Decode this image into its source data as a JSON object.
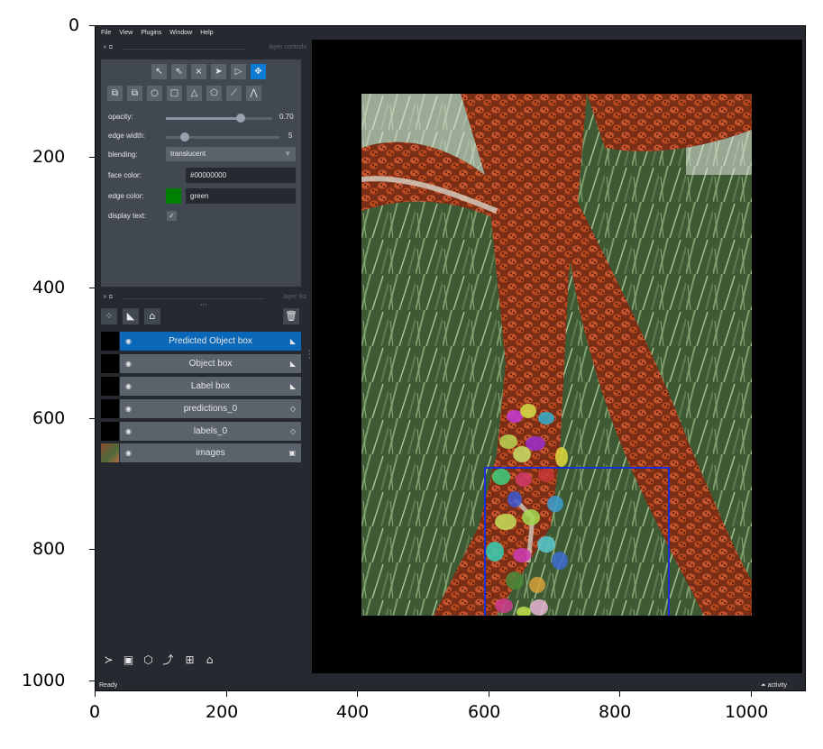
{
  "axes": {
    "x_ticks": [
      "0",
      "200",
      "400",
      "600",
      "800",
      "1000"
    ],
    "y_ticks": [
      "0",
      "200",
      "400",
      "600",
      "800",
      "1000"
    ]
  },
  "menubar": [
    "File",
    "View",
    "Plugins",
    "Window",
    "Help"
  ],
  "layer_controls": {
    "header": "layer controls",
    "opacity_label": "opacity:",
    "opacity_value": "0.70",
    "opacity_level": 0.7,
    "edge_width_label": "edge width:",
    "edge_width_value": "5",
    "blending_label": "blending:",
    "blending_value": "translucent",
    "face_color_label": "face color:",
    "face_color_value": "#00000000",
    "edge_color_label": "edge color:",
    "edge_color_value": "green",
    "edge_color_swatch": "#008000",
    "display_text_label": "display text:",
    "display_text_checked": true
  },
  "layer_list": {
    "header": "layer list",
    "layers": [
      {
        "name": "Predicted Object box",
        "type": "shapes",
        "selected": true
      },
      {
        "name": "Object box",
        "type": "shapes",
        "selected": false
      },
      {
        "name": "Label box",
        "type": "shapes",
        "selected": false
      },
      {
        "name": "predictions_0",
        "type": "labels",
        "selected": false
      },
      {
        "name": "labels_0",
        "type": "labels",
        "selected": false
      },
      {
        "name": "images",
        "type": "image",
        "selected": false
      }
    ]
  },
  "status": {
    "left": "Ready",
    "right": "activity"
  },
  "colors": {
    "accent": "#0b7bd4",
    "bbox": "#1a2fd6",
    "panel": "#262930",
    "control": "#414851"
  }
}
